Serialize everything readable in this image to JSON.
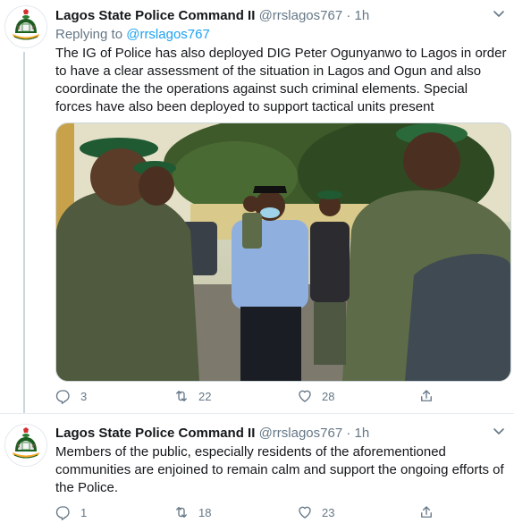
{
  "tweets": [
    {
      "author_name": "Lagos State Police Command II",
      "author_handle": "@rrslagos767",
      "separator": "·",
      "time": "1h",
      "replying_prefix": "Replying to",
      "replying_handle": "@rrslagos767",
      "text": "The IG of Police has also deployed DIG Peter Ogunyanwo to Lagos in order to have a clear assessment of the situation in Lagos and Ogun and also coordinate the the operations against such criminal elements. Special forces have also been deployed to support tactical units present",
      "reply_count": "3",
      "retweet_count": "22",
      "like_count": "28"
    },
    {
      "author_name": "Lagos State Police Command II",
      "author_handle": "@rrslagos767",
      "separator": "·",
      "time": "1h",
      "text": "Members of the public, especially residents of the aforementioned communities are enjoined to remain calm and support the ongoing efforts of the Police.",
      "reply_count": "1",
      "retweet_count": "18",
      "like_count": "23"
    }
  ],
  "icons": {
    "avatar": "police-crest-icon",
    "menu": "chevron-down-icon",
    "reply": "reply-icon",
    "retweet": "retweet-icon",
    "like": "heart-icon",
    "share": "share-icon"
  },
  "colors": {
    "link": "#1da1f2",
    "muted": "#657786",
    "text": "#14171a"
  }
}
